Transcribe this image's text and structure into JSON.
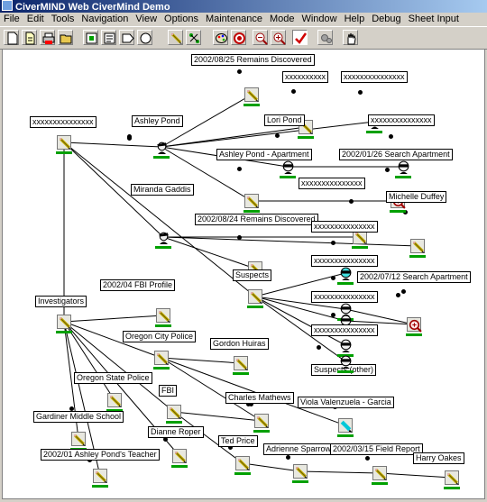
{
  "app": {
    "title": "CiverMIND Web CiverMind Demo"
  },
  "menu": [
    "File",
    "Edit",
    "Tools",
    "Navigation",
    "View",
    "Options",
    "Maintenance",
    "Mode",
    "Window",
    "Help",
    "Debug",
    "Sheet Input"
  ],
  "toolbar": [
    {
      "icon": "new-document-icon"
    },
    {
      "icon": "copy-document-icon"
    },
    {
      "icon": "print-icon"
    },
    {
      "icon": "open-folder-icon"
    },
    {
      "icon": "node-view-icon"
    },
    {
      "icon": "report-icon"
    },
    {
      "icon": "tag-shape-icon"
    },
    {
      "icon": "circle-shape-icon"
    },
    {
      "icon": "pencil-icon"
    },
    {
      "icon": "link-tool-icon"
    },
    {
      "icon": "palette-icon"
    },
    {
      "icon": "stop-icon"
    },
    {
      "icon": "zoom-out-icon"
    },
    {
      "icon": "zoom-in-icon"
    },
    {
      "icon": "checkmark-icon",
      "active": true
    },
    {
      "icon": "gears-icon"
    },
    {
      "icon": "hand-icon"
    }
  ],
  "nodes": [
    {
      "id": "root",
      "label": "xxxxxxxxxxxxxxx",
      "icon": "pencil-icon"
    },
    {
      "id": "ashley",
      "label": "Ashley Pond",
      "icon": "suspect-profile-icon"
    },
    {
      "id": "remains1",
      "label": "2002/08/25 Remains Discovered",
      "icon": "pencil-icon"
    },
    {
      "id": "x1",
      "label": "xxxxxxxxxx",
      "icon": "pencil-icon"
    },
    {
      "id": "x2",
      "label": "xxxxxxxxxxxxxxx",
      "icon": "person-mask-icon"
    },
    {
      "id": "lori",
      "label": "Lori Pond",
      "icon": "person-mask-icon"
    },
    {
      "id": "x3",
      "label": "xxxxxxxxxxxxxxx",
      "icon": "person-mask-icon"
    },
    {
      "id": "apartment",
      "label": "Ashley Pond - Apartment",
      "icon": "pencil-icon"
    },
    {
      "id": "search1",
      "label": "2002/01/26 Search Apartment",
      "icon": "magnifier-icon"
    },
    {
      "id": "miranda",
      "label": "Miranda Gaddis",
      "icon": "suspect-profile-icon"
    },
    {
      "id": "x4",
      "label": "xxxxxxxxxxxxxxx",
      "icon": "pencil-icon"
    },
    {
      "id": "michelle",
      "label": "Michelle Duffey",
      "icon": "pencil-icon"
    },
    {
      "id": "remains2",
      "label": "2002/08/24 Remains Discovered",
      "icon": "pencil-icon"
    },
    {
      "id": "suspects",
      "label": "Suspects",
      "icon": "pencil-icon"
    },
    {
      "id": "s1",
      "label": "xxxxxxxxxxxxxxx",
      "icon": "person-cyan-mask-icon"
    },
    {
      "id": "s2",
      "label": "xxxxxxxxxxxxxxx",
      "icon": "person-mask-icon"
    },
    {
      "id": "search2",
      "label": "2002/07/12 Search Apartment",
      "icon": "magnifier-icon"
    },
    {
      "id": "s3",
      "label": "xxxxxxxxxxxxxxx",
      "icon": "person-mask-icon"
    },
    {
      "id": "s4",
      "label": "xxxxxxxxxxxxxxx",
      "icon": "person-mask-icon"
    },
    {
      "id": "suspects_other",
      "label": "Suspects (other)",
      "icon": "person-mask-icon"
    },
    {
      "id": "investigators",
      "label": "Investigators",
      "icon": "pencil-icon"
    },
    {
      "id": "fbi_profile",
      "label": "2002/04 FBI Profile",
      "icon": "pencil-icon"
    },
    {
      "id": "oregon_city",
      "label": "Oregon City Police",
      "icon": "pencil-icon"
    },
    {
      "id": "gordon",
      "label": "Gordon Huiras",
      "icon": "pencil-icon"
    },
    {
      "id": "osp",
      "label": "Oregon State Police",
      "icon": "pencil-icon"
    },
    {
      "id": "fbi",
      "label": "FBI",
      "icon": "pencil-icon"
    },
    {
      "id": "charles",
      "label": "Charles Mathews",
      "icon": "pencil-icon"
    },
    {
      "id": "viola",
      "label": "Viola Valenzuela - Garcia",
      "icon": "marker-cyan-icon"
    },
    {
      "id": "gardiner",
      "label": "Gardiner Middle School",
      "icon": "pencil-icon"
    },
    {
      "id": "dianne",
      "label": "Dianne Roper",
      "icon": "pencil-icon"
    },
    {
      "id": "ted",
      "label": "Ted Price",
      "icon": "pencil-icon"
    },
    {
      "id": "teacher",
      "label": "2002/01 Ashley Pond's Teacher",
      "icon": "pencil-icon"
    },
    {
      "id": "adrienne",
      "label": "Adrienne Sparrow",
      "icon": "pencil-icon"
    },
    {
      "id": "field_report",
      "label": "2002/03/15 Field Report",
      "icon": "pencil-icon"
    },
    {
      "id": "harry",
      "label": "Harry Oakes",
      "icon": "pencil-icon"
    }
  ]
}
